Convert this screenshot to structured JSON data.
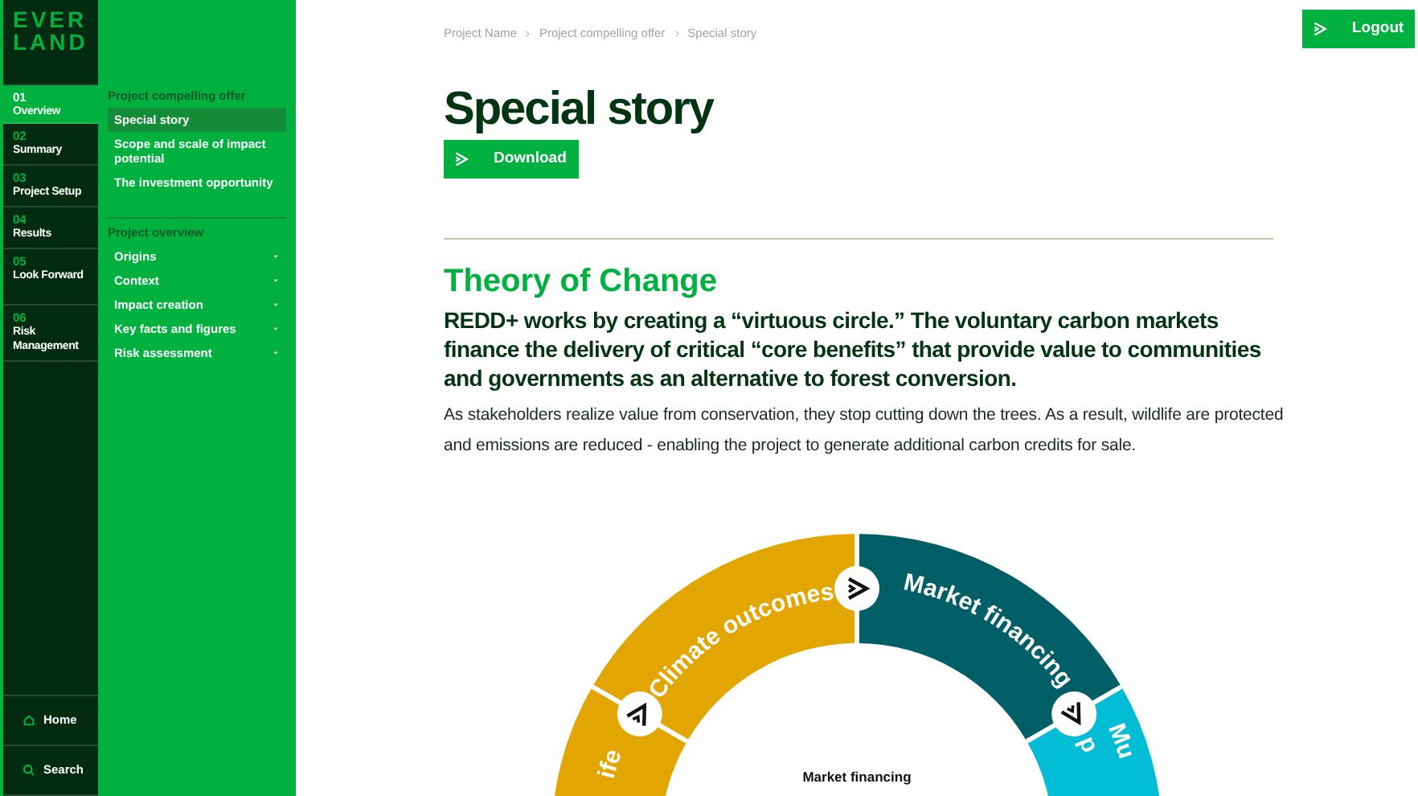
{
  "logo": {
    "lines": [
      "EVER",
      "LAND"
    ]
  },
  "nav": [
    {
      "number": "01",
      "label": "Overview",
      "selected": true
    },
    {
      "number": "02",
      "label": "Summary",
      "selected": false
    },
    {
      "number": "03",
      "label": "Project Setup",
      "selected": false
    },
    {
      "number": "04",
      "label": "Results",
      "selected": false
    },
    {
      "number": "05",
      "label": "Look Forward",
      "selected": false
    },
    {
      "number": "06",
      "label": "Risk Management",
      "selected": false
    }
  ],
  "bottom_nav": [
    {
      "label": "Home",
      "kind": "home"
    },
    {
      "label": "Search",
      "kind": "search"
    }
  ],
  "subnav": [
    {
      "heading": "Project compelling offer",
      "items": [
        {
          "label": "Special story",
          "selected": true,
          "has_submenu": false
        },
        {
          "label": "Scope and scale of impact potential",
          "selected": false,
          "has_submenu": false
        },
        {
          "label": "The investment opportunity",
          "selected": false,
          "has_submenu": false
        }
      ]
    },
    {
      "heading": "Project overview",
      "items": [
        {
          "label": "Origins",
          "selected": false,
          "has_submenu": true
        },
        {
          "label": "Context",
          "selected": false,
          "has_submenu": true
        },
        {
          "label": "Impact creation",
          "selected": false,
          "has_submenu": true
        },
        {
          "label": "Key facts and figures",
          "selected": false,
          "has_submenu": true
        },
        {
          "label": "Risk assessment",
          "selected": false,
          "has_submenu": true
        }
      ]
    }
  ],
  "breadcrumb": [
    "Project Name",
    "Project compelling offer",
    "Special story"
  ],
  "logout_button": "Logout",
  "title": "Special story",
  "download_button": "Download",
  "section_heading": "Theory of Change",
  "lead": "REDD+ works by creating a “virtuous circle.” The voluntary carbon markets finance the delivery of critical “core benefits” that provide value to communities and governments as an alternative to forest conversion.",
  "body": "As stakeholders realize value from conservation, they stop cutting down the trees. As a result, wildlife are protected and emissions are reduced - enabling the project to generate additional carbon credits for sale.",
  "diagram": {
    "segments": [
      {
        "lines": [
          "ife"
        ],
        "color": "#e3a600"
      },
      {
        "lines": [
          "Climate outcomes"
        ],
        "color": "#e3a600"
      },
      {
        "lines": [
          "Market financing"
        ],
        "color": "#005e66"
      },
      {
        "lines": [
          "p",
          "Mu"
        ],
        "color": "#00bcd4"
      }
    ],
    "center_label": "Market financing"
  }
}
